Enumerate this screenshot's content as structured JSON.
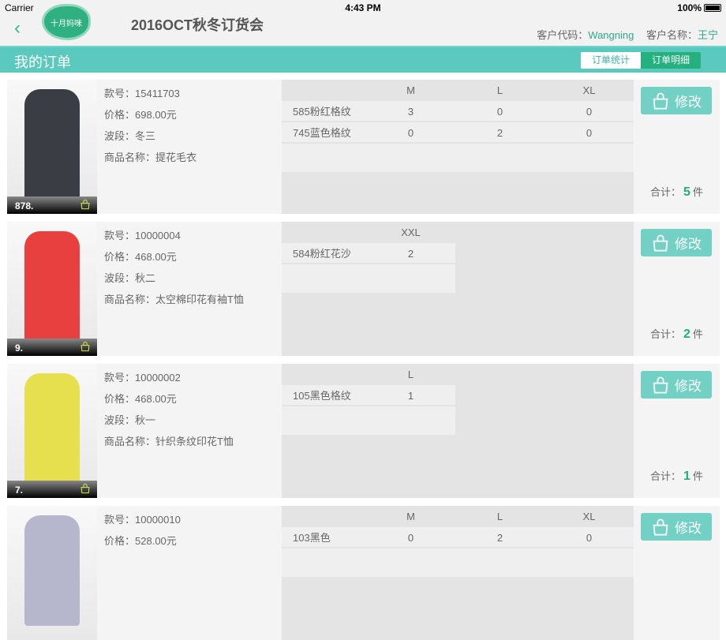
{
  "status": {
    "carrier": "Carrier",
    "time": "4:43 PM",
    "battery": "100%"
  },
  "header": {
    "logo": "十月妈咪",
    "title": "2016OCT秋冬订货会",
    "customer_code_label": "客户代码：",
    "customer_code": "Wangning",
    "customer_name_label": "客户名称：",
    "customer_name": "王宁"
  },
  "bar": {
    "title": "我的订单",
    "tabs": [
      "订单统计",
      "订单明细"
    ]
  },
  "labels": {
    "style": "款号：",
    "price": "价格：",
    "wave": "波段：",
    "name": "商品名称：",
    "edit": "修改",
    "total": "合计：",
    "unit": "件"
  },
  "items": [
    {
      "num": "878.",
      "style": "15411703",
      "price": "698.00元",
      "wave": "冬三",
      "name": "提花毛衣",
      "sizes": [
        "M",
        "L",
        "XL"
      ],
      "rows": [
        {
          "color": "585粉红格纹",
          "qty": [
            "3",
            "0",
            "0"
          ]
        },
        {
          "color": "745蓝色格纹",
          "qty": [
            "0",
            "2",
            "0"
          ]
        }
      ],
      "total": "5",
      "garment_color": "#3b3d45"
    },
    {
      "num": "9.",
      "style": "10000004",
      "price": "468.00元",
      "wave": "秋二",
      "name": "太空棉印花有袖T恤",
      "sizes": [
        "XXL"
      ],
      "rows": [
        {
          "color": "584粉红花沙",
          "qty": [
            "2"
          ]
        }
      ],
      "total": "2",
      "garment_color": "#e8403e"
    },
    {
      "num": "7.",
      "style": "10000002",
      "price": "468.00元",
      "wave": "秋一",
      "name": "针织条纹印花T恤",
      "sizes": [
        "L"
      ],
      "rows": [
        {
          "color": "105黑色格纹",
          "qty": [
            "1"
          ]
        }
      ],
      "total": "1",
      "garment_color": "#e6e04e"
    },
    {
      "num": "",
      "style": "10000010",
      "price": "528.00元",
      "wave": "",
      "name": "",
      "sizes": [
        "M",
        "L",
        "XL"
      ],
      "rows": [
        {
          "color": "103黑色",
          "qty": [
            "0",
            "2",
            "0"
          ]
        }
      ],
      "total": "",
      "garment_color": "#b6b6cc"
    }
  ]
}
